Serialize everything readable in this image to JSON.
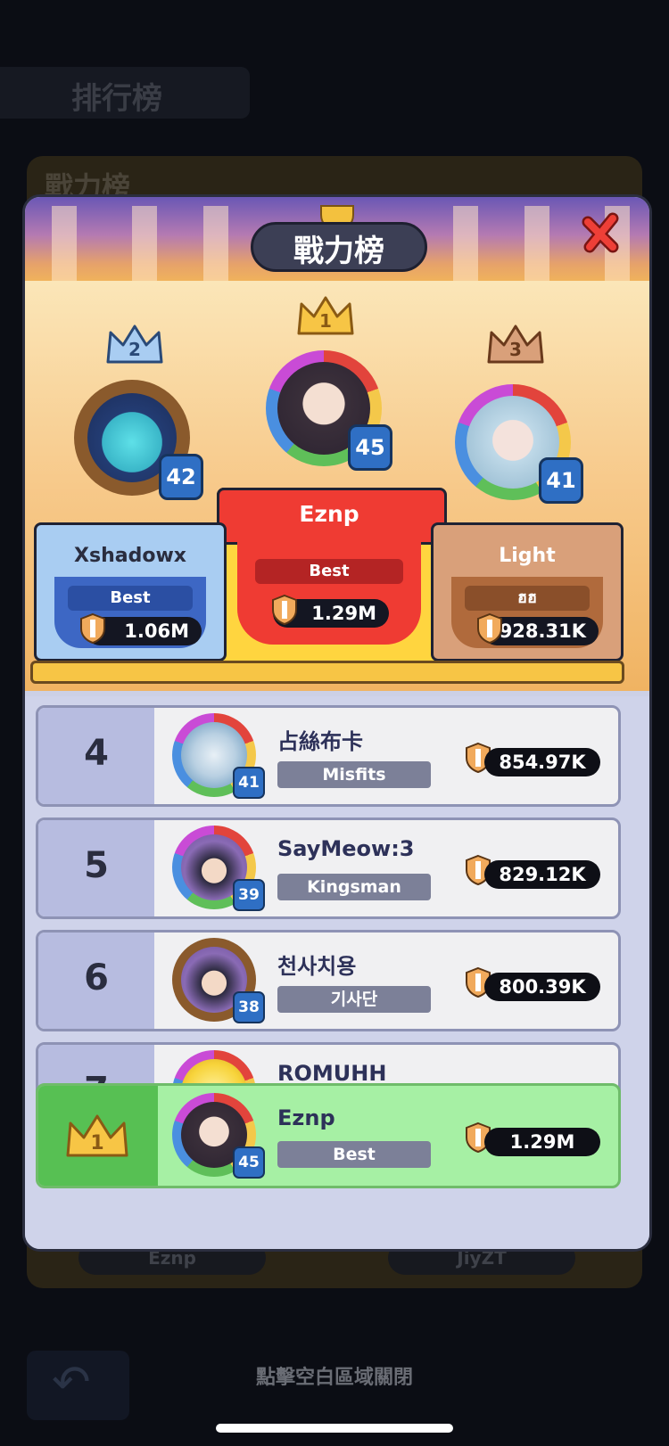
{
  "background": {
    "title": "排行榜",
    "card_title": "戰力榜",
    "pill_left": "Eznp",
    "pill_right": "JiyZT",
    "close_hint": "點擊空白區域關閉"
  },
  "panel": {
    "title": "戰力榜"
  },
  "podium": [
    {
      "rank": "1",
      "name": "Eznp",
      "guild": "Best",
      "score": "1.29M",
      "level": "45"
    },
    {
      "rank": "2",
      "name": "Xshadowx",
      "guild": "Best",
      "score": "1.06M",
      "level": "42"
    },
    {
      "rank": "3",
      "name": "Light",
      "guild": "ฮฮ",
      "score": "928.31K",
      "level": "41"
    }
  ],
  "ranking_list": [
    {
      "rank": "4",
      "name": "占絲布卡",
      "guild": "Misfits",
      "score": "854.97K",
      "level": "41"
    },
    {
      "rank": "5",
      "name": "SayMeow:3",
      "guild": "Kingsman",
      "score": "829.12K",
      "level": "39"
    },
    {
      "rank": "6",
      "name": "천사치용",
      "guild": "기사단",
      "score": "800.39K",
      "level": "38"
    },
    {
      "rank": "7",
      "name": "ROMUHH",
      "guild": "",
      "score": "",
      "level": ""
    }
  ],
  "my_rank": {
    "rank": "1",
    "name": "Eznp",
    "guild": "Best",
    "score": "1.29M",
    "level": "45"
  },
  "colors": {
    "gold": "#f7c545",
    "silver_blue": "#a9cdf2",
    "bronze": "#c8885a",
    "red": "#e03a32",
    "highlight_green": "#a6f0a4"
  }
}
